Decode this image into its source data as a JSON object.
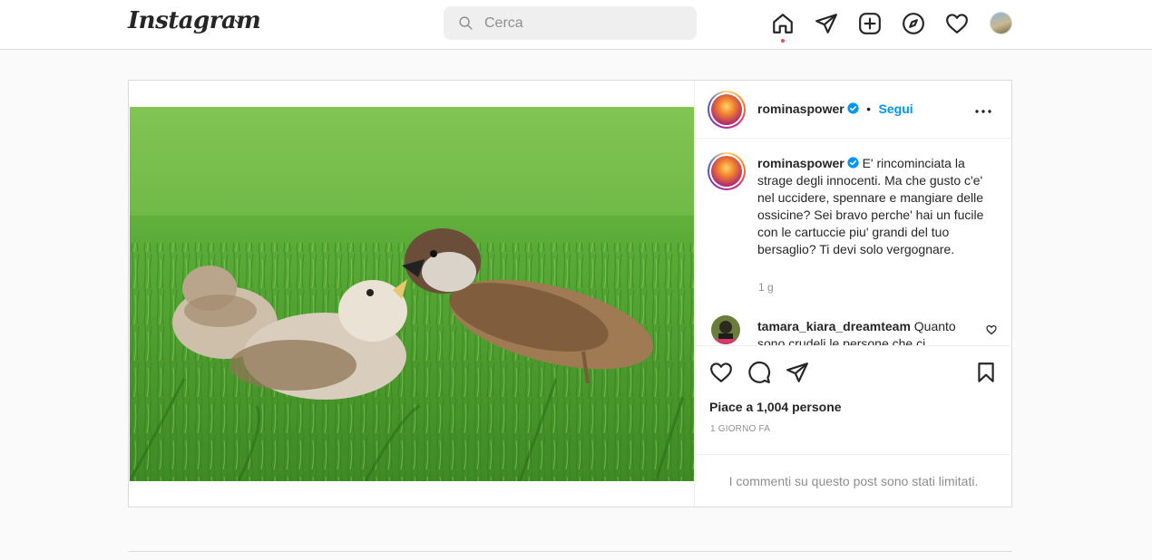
{
  "colors": {
    "accent": "#0095f6",
    "notification": "#ed4956",
    "border": "#dbdbdb",
    "muted": "#8e8e8e"
  },
  "header": {
    "logo": "Instagram",
    "search_placeholder": "Cerca",
    "nav_icons": [
      "home-icon",
      "direct-icon",
      "new-post-icon",
      "explore-icon",
      "activity-icon",
      "profile-avatar"
    ]
  },
  "post": {
    "author": "rominaspower",
    "follow_label": "Segui",
    "separator": "•",
    "caption": "E' rincominciata la strage degli innocenti. Ma che gusto c'e' nel uccidere, spennare e mangiare delle ossicine? Sei bravo perche' hai un fucile con le cartuccie piu' grandi del tuo bersaglio? Ti devi solo vergognare.",
    "caption_time": "1 g",
    "comments": [
      {
        "user": "tamara_kiara_dreamteam",
        "text": "Quanto sono crudeli le persone che ci"
      }
    ],
    "likes_text": "Piace a 1,004 persone",
    "date": "1 GIORNO FA",
    "comments_limited": "I commenti su questo post sono stati limitati."
  }
}
